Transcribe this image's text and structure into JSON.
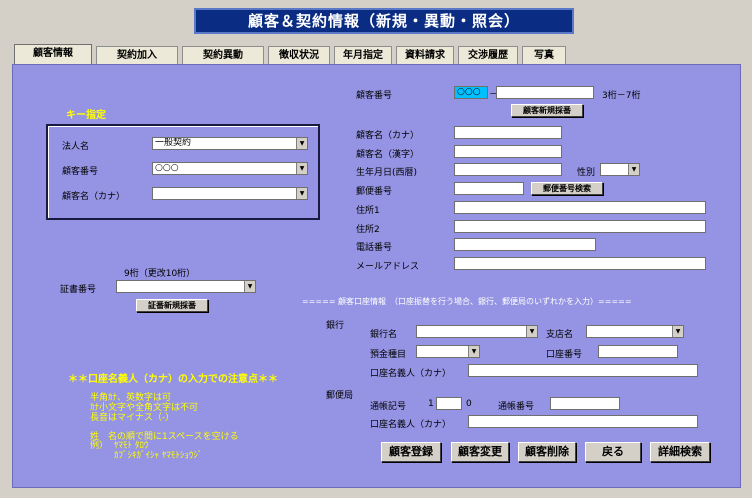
{
  "window": {
    "title": "顧客＆契約情報（新規・異動・照会）"
  },
  "tabs": [
    {
      "label": "顧客情報",
      "active": true
    },
    {
      "label": "契約加入"
    },
    {
      "label": "契約異動"
    },
    {
      "label": "徴収状況"
    },
    {
      "label": "年月指定"
    },
    {
      "label": "資料請求"
    },
    {
      "label": "交渉履歴"
    },
    {
      "label": "写真"
    }
  ],
  "key_section": {
    "heading": "キー指定",
    "corp_label": "法人名",
    "corp_value": "一般契約",
    "custno_label": "顧客番号",
    "custno_value": "○○○",
    "kana_label": "顧客名（カナ）",
    "kana_value": ""
  },
  "certificate": {
    "hint": "9桁（更改10桁）",
    "label": "証書番号",
    "value": "",
    "new_search_button": "証番新規採番"
  },
  "notes": {
    "heading": "＊＊口座名義人（カナ）の入力での注意点＊＊",
    "line1": "半角ｶﾅ、英数字は可",
    "line2": "ｶﾅ小文字や全角文字は不可",
    "line3": "長音はマイナス（-）",
    "line4": "姓　名の順で間に1スペースを空ける",
    "example_label": "例）",
    "example1": "ﾔﾏﾓﾄ ﾀﾛｳ",
    "example2": "ｶﾌﾞｼｷｶﾞｲｼｬ ﾔﾏﾓﾄｼｮｳｼﾞ"
  },
  "customer": {
    "custno_label": "顧客番号",
    "custno_prefix": "○○○",
    "custno_separator": "－",
    "custno_value": "",
    "custno_hint": "3桁－7桁",
    "new_custno_button": "顧客新規採番",
    "kana_label": "顧客名（カナ）",
    "kanji_label": "顧客名（漢字）",
    "birth_label": "生年月日(西暦)",
    "gender_label": "性別",
    "zip_label": "郵便番号",
    "zip_search_button": "郵便番号検索",
    "addr1_label": "住所1",
    "addr2_label": "住所2",
    "tel_label": "電話番号",
    "mail_label": "メールアドレス"
  },
  "bank": {
    "section_heading": "===== 顧客口座情報　（口座振替を行う場合、銀行、郵便局のいずれかを入力）=====",
    "bank_group_label": "銀行",
    "bank_name_label": "銀行名",
    "branch_label": "支店名",
    "deposit_type_label": "預金種目",
    "account_no_label": "口座番号",
    "holder_label": "口座名義人（カナ）",
    "post_group_label": "郵便局",
    "passbook_label": "通帳記号",
    "passbook_prefix": "1",
    "passbook_suffix": "0",
    "passbook_no_label": "通帳番号",
    "post_holder_label": "口座名義人（カナ）"
  },
  "actions": {
    "register": "顧客登録",
    "modify": "顧客変更",
    "delete": "顧客削除",
    "back": "戻る",
    "detail_search": "詳細検索"
  }
}
